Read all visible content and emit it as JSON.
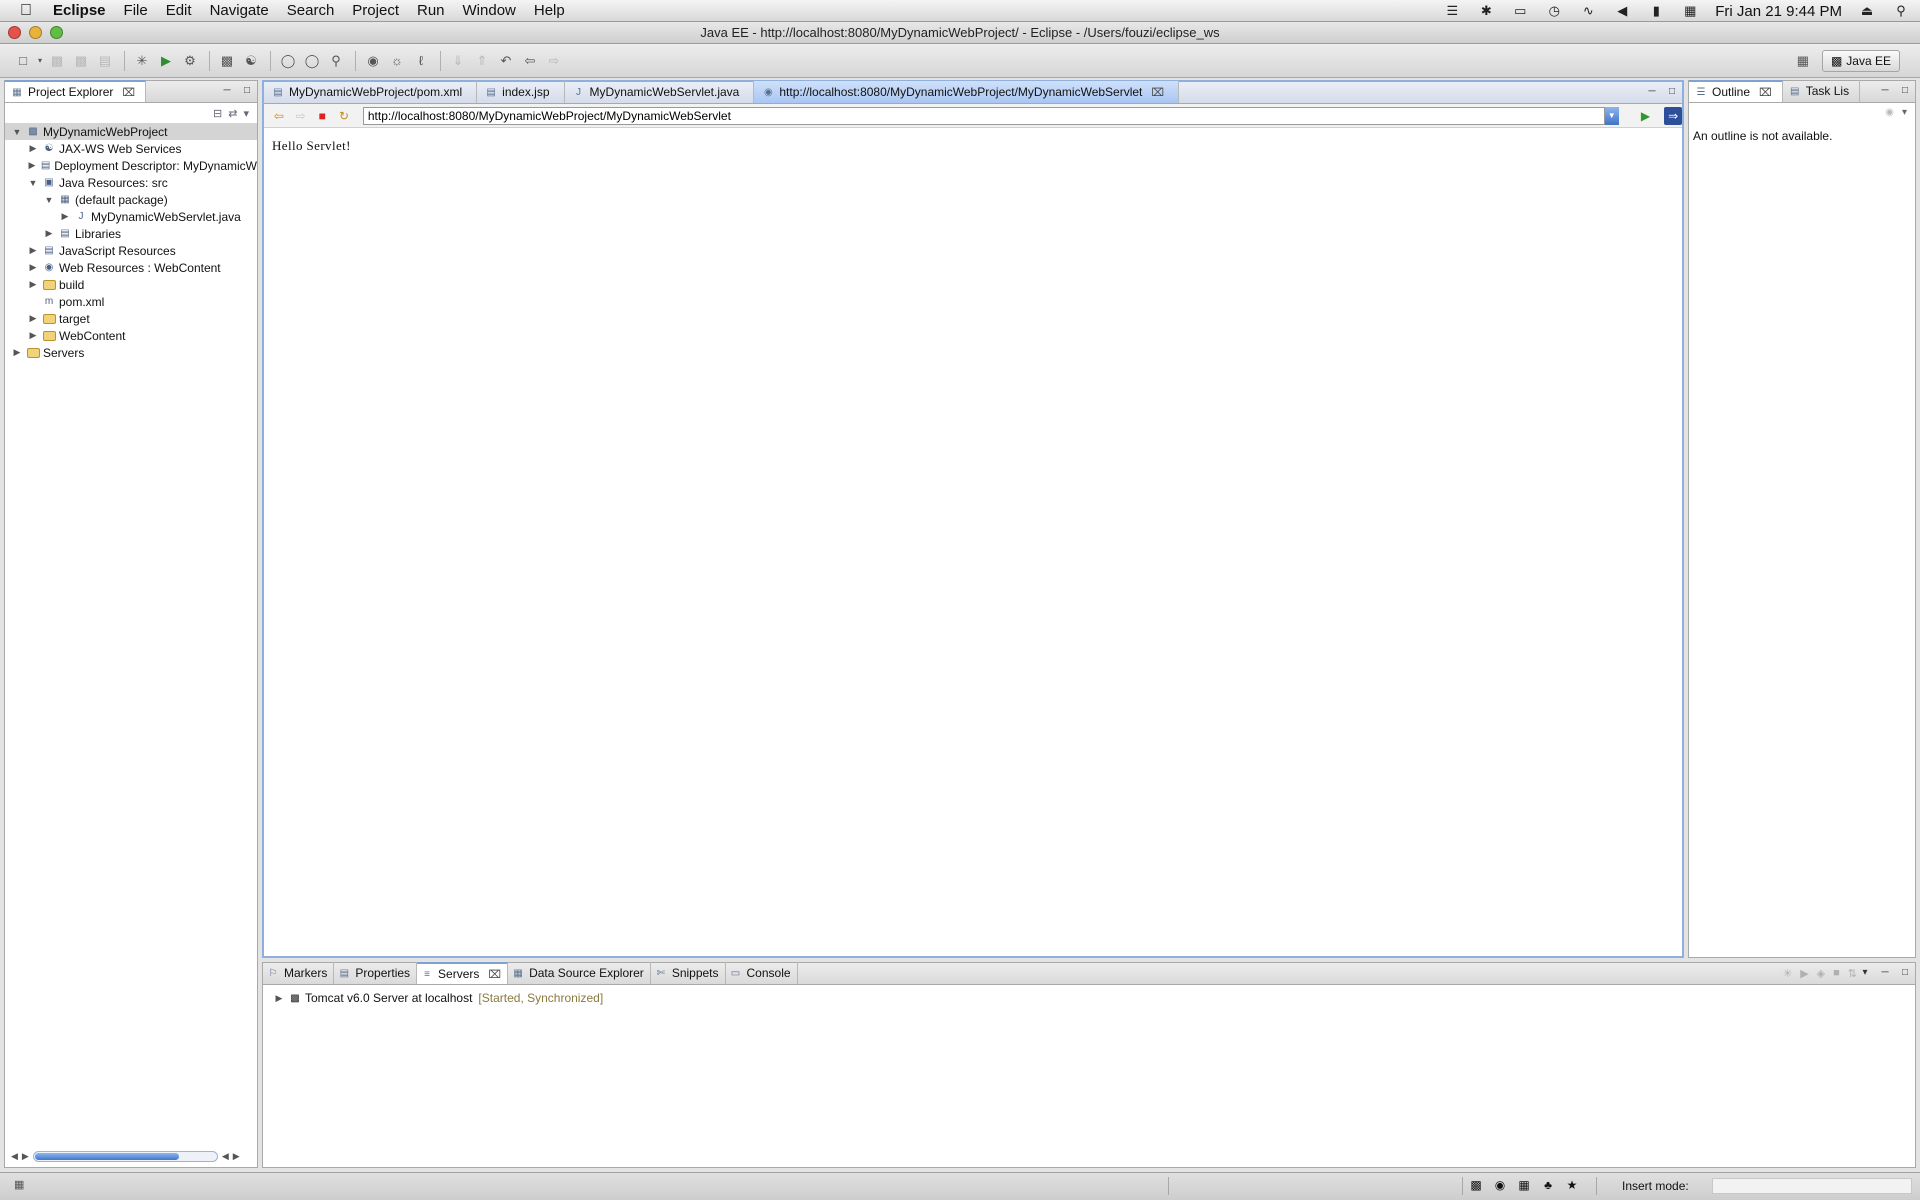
{
  "menubar": {
    "app_name": "Eclipse",
    "items": [
      "File",
      "Edit",
      "Navigate",
      "Search",
      "Project",
      "Run",
      "Window",
      "Help"
    ],
    "clock": "Fri Jan 21  9:44 PM"
  },
  "window": {
    "title": "Java EE - http://localhost:8080/MyDynamicWebProject/ - Eclipse - /Users/fouzi/eclipse_ws"
  },
  "toolbar": {
    "perspective_label": "Java EE"
  },
  "explorer": {
    "tab_label": "Project Explorer",
    "tree": [
      {
        "label": "MyDynamicWebProject",
        "depth": 0,
        "twisty": "open",
        "icon": "project-icon",
        "selected": true
      },
      {
        "label": "JAX-WS Web Services",
        "depth": 1,
        "twisty": "closed",
        "icon": "web-services-icon"
      },
      {
        "label": "Deployment Descriptor: MyDynamicW",
        "depth": 1,
        "twisty": "closed",
        "icon": "deployment-descriptor-icon"
      },
      {
        "label": "Java Resources: src",
        "depth": 1,
        "twisty": "open",
        "icon": "java-resources-icon"
      },
      {
        "label": "(default package)",
        "depth": 2,
        "twisty": "open",
        "icon": "package-icon"
      },
      {
        "label": "MyDynamicWebServlet.java",
        "depth": 3,
        "twisty": "closed",
        "icon": "java-file-icon"
      },
      {
        "label": "Libraries",
        "depth": 2,
        "twisty": "closed",
        "icon": "libraries-icon"
      },
      {
        "label": "JavaScript Resources",
        "depth": 1,
        "twisty": "closed",
        "icon": "javascript-resources-icon"
      },
      {
        "label": "Web Resources : WebContent",
        "depth": 1,
        "twisty": "closed",
        "icon": "web-resources-icon"
      },
      {
        "label": "build",
        "depth": 1,
        "twisty": "closed",
        "icon": "folder-icon"
      },
      {
        "label": "pom.xml",
        "depth": 1,
        "twisty": "none",
        "icon": "xml-file-icon"
      },
      {
        "label": "target",
        "depth": 1,
        "twisty": "closed",
        "icon": "folder-icon"
      },
      {
        "label": "WebContent",
        "depth": 1,
        "twisty": "closed",
        "icon": "folder-icon"
      },
      {
        "label": "Servers",
        "depth": 0,
        "twisty": "closed",
        "icon": "folder-icon"
      }
    ]
  },
  "editor": {
    "tabs": [
      {
        "label": "MyDynamicWebProject/pom.xml",
        "icon": "xml-file-icon",
        "active": false
      },
      {
        "label": "index.jsp",
        "icon": "jsp-file-icon",
        "active": false
      },
      {
        "label": "MyDynamicWebServlet.java",
        "icon": "java-file-icon",
        "active": false
      },
      {
        "label": "http://localhost:8080/MyDynamicWebProject/MyDynamicWebServlet",
        "icon": "globe-icon",
        "active": true
      }
    ],
    "url": "http://localhost:8080/MyDynamicWebProject/MyDynamicWebServlet",
    "page_text": "Hello Servlet!"
  },
  "outline": {
    "tabs": [
      "Outline",
      "Task Lis"
    ],
    "message": "An outline is not available."
  },
  "bottom_panel": {
    "tabs": [
      {
        "label": "Markers",
        "icon": "markers-icon",
        "active": false
      },
      {
        "label": "Properties",
        "icon": "properties-icon",
        "active": false
      },
      {
        "label": "Servers",
        "icon": "servers-icon",
        "active": true
      },
      {
        "label": "Data Source Explorer",
        "icon": "data-source-icon",
        "active": false
      },
      {
        "label": "Snippets",
        "icon": "snippets-icon",
        "active": false
      },
      {
        "label": "Console",
        "icon": "console-icon",
        "active": false
      }
    ],
    "server_name": "Tomcat v6.0 Server at localhost",
    "server_status": "[Started, Synchronized]"
  },
  "statusbar": {
    "insert_mode_label": "Insert mode:"
  },
  "colors": {
    "accent": "#7fa2d4",
    "editor_border": "#8fb0de",
    "server_status": "#8a7a3c"
  }
}
